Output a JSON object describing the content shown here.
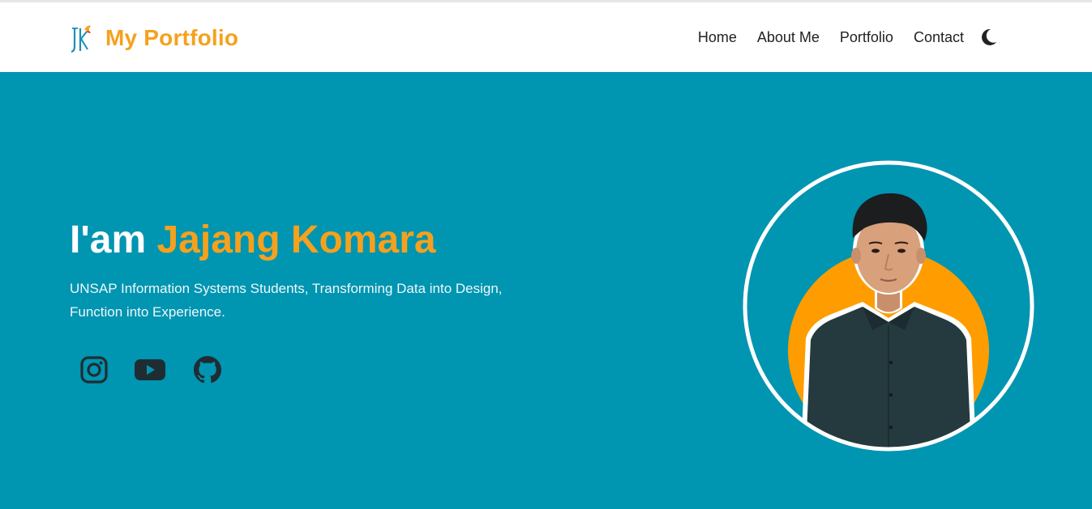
{
  "header": {
    "brand": {
      "logo_icon": "jk-logo-icon",
      "title": "My Portfolio"
    },
    "nav": [
      {
        "label": "Home"
      },
      {
        "label": "About Me"
      },
      {
        "label": "Portfolio"
      },
      {
        "label": "Contact"
      }
    ],
    "theme_toggle_icon": "moon-icon"
  },
  "hero": {
    "greeting": "I'am",
    "name": "Jajang Komara",
    "description": "UNSAP Information Systems Students, Transforming Data into Design, Function into Experience.",
    "socials": [
      {
        "icon": "instagram-icon"
      },
      {
        "icon": "youtube-icon"
      },
      {
        "icon": "github-icon"
      }
    ],
    "profile_image": "profile-photo"
  },
  "colors": {
    "accent": "#f5a11d",
    "hero_bg": "#0095b1",
    "circle_orange": "#ff9d00",
    "text_dark": "#222222"
  }
}
